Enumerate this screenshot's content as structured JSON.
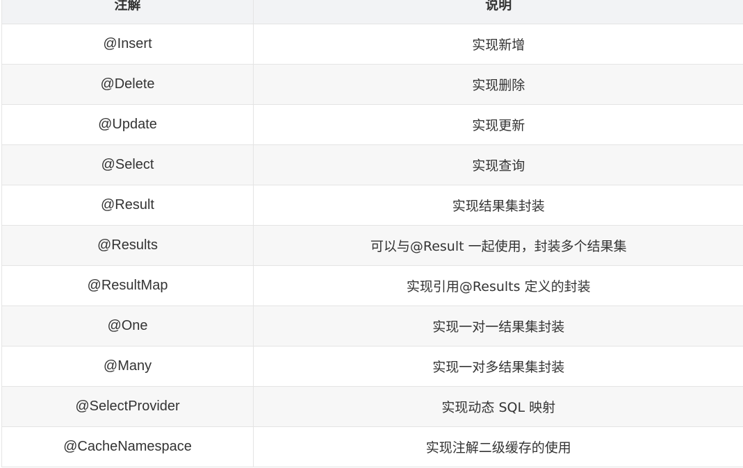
{
  "table": {
    "headers": [
      "注解",
      "说明"
    ],
    "rows": [
      {
        "annotation": "@Insert",
        "description": "实现新增"
      },
      {
        "annotation": "@Delete",
        "description": "实现删除"
      },
      {
        "annotation": "@Update",
        "description": "实现更新"
      },
      {
        "annotation": "@Select",
        "description": "实现查询"
      },
      {
        "annotation": "@Result",
        "description": "实现结果集封装"
      },
      {
        "annotation": "@Results",
        "description": "可以与@Result 一起使用，封装多个结果集"
      },
      {
        "annotation": "@ResultMap",
        "description": "实现引用@Results 定义的封装"
      },
      {
        "annotation": "@One",
        "description": "实现一对一结果集封装"
      },
      {
        "annotation": "@Many",
        "description": "实现一对多结果集封装"
      },
      {
        "annotation": "@SelectProvider",
        "description": "实现动态 SQL 映射"
      },
      {
        "annotation": "@CacheNamespace",
        "description": "实现注解二级缓存的使用"
      }
    ]
  }
}
